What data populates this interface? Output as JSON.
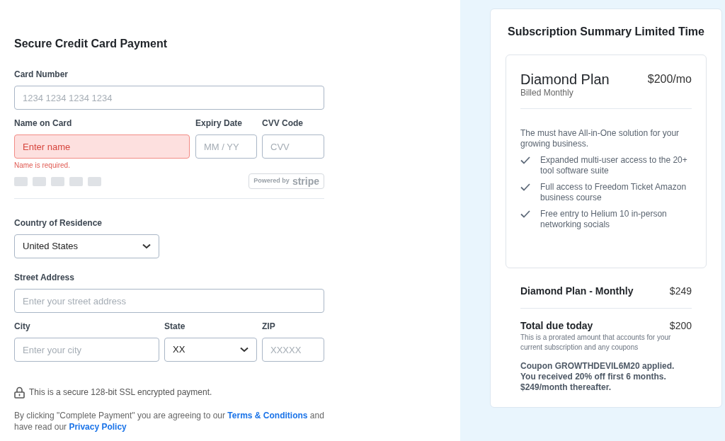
{
  "form": {
    "title": "Secure Credit Card Payment",
    "card_number": {
      "label": "Card Number",
      "placeholder": "1234 1234 1234 1234",
      "error": false
    },
    "name_on_card": {
      "label": "Name on Card",
      "placeholder": "Enter name",
      "error": true,
      "error_text": "Name is required."
    },
    "expiry": {
      "label": "Expiry Date",
      "placeholder": "MM / YY",
      "error": false
    },
    "cvv": {
      "label": "CVV Code",
      "placeholder": "CVV",
      "error": false
    },
    "stripe_badge": {
      "prefix": "Powered by",
      "brand": "stripe"
    },
    "country": {
      "label": "Country of Residence",
      "value": "United States"
    },
    "street": {
      "label": "Street Address",
      "placeholder": "Enter your street address",
      "error": false
    },
    "city": {
      "label": "City",
      "placeholder": "Enter your city",
      "error": false
    },
    "state": {
      "label": "State",
      "value": "XX"
    },
    "zip": {
      "label": "ZIP",
      "placeholder": "XXXXX",
      "error": false
    },
    "secure_note": "This is a secure 128-bit SSL encrypted payment.",
    "legal": [
      {
        "kind": "text",
        "text": "By clicking \"Complete Payment\" you are agreeing to our "
      },
      {
        "kind": "link",
        "text": "Terms & Conditions"
      },
      {
        "kind": "text",
        "text": " and have read our "
      },
      {
        "kind": "link",
        "text": "Privacy Policy"
      }
    ]
  },
  "summary": {
    "title": "Subscription Summary Limited Time",
    "plan": {
      "name": "Diamond Plan",
      "price": "$200/mo",
      "billing": "Billed Monthly",
      "description": "The must have All-in-One solution for your growing business.",
      "features": [
        {
          "text": "Expanded multi-user access to the 20+ tool software suite",
          "checked": true
        },
        {
          "text": "Full access to Freedom Ticket Amazon business course",
          "checked": true
        },
        {
          "text": "Free entry to Helium 10 in-person networking socials",
          "checked": true
        }
      ]
    },
    "line_item": {
      "label": "Diamond Plan - Monthly",
      "amount": "$249"
    },
    "total": {
      "label": "Total due today",
      "amount": "$200",
      "note": "This is a prorated amount that accounts for your current subscription and any coupons"
    },
    "coupon_note": "Coupon GROWTHDEVIL6M20 applied. You received 20% off first 6 months. $249/month thereafter."
  }
}
